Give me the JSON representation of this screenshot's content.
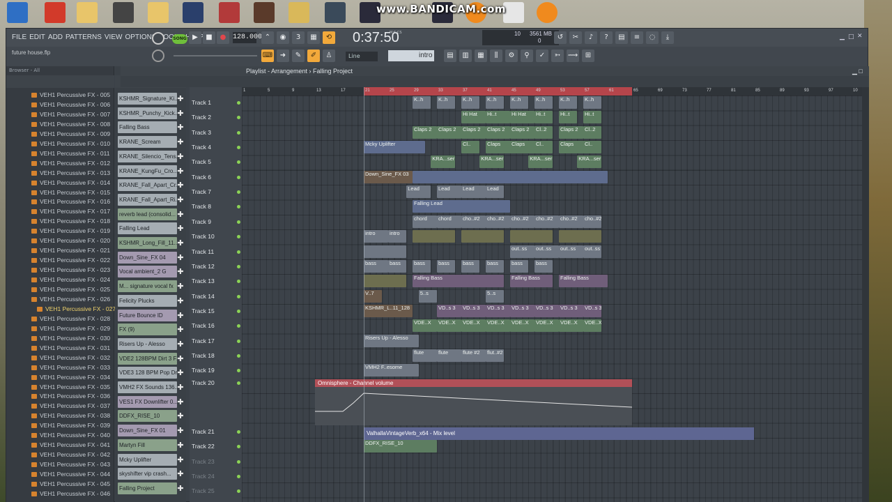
{
  "watermark": "www.BANDICAM.com",
  "menu": [
    "FILE",
    "EDIT",
    "ADD",
    "PATTERNS",
    "VIEW",
    "OPTIONS",
    "TOOLS",
    "HELP"
  ],
  "hint": "future house.flp",
  "transport": {
    "mode": "SONG",
    "tempo": "128.000",
    "time": "0:37:50",
    "time_label": "M:S:CS",
    "cpu_a": "10",
    "cpu_b": "3561 MB",
    "cpu_c": "0"
  },
  "snap": "Line",
  "pattern": "intro",
  "browser": {
    "header": "Browser - All",
    "items": [
      "VEH1 Percussive FX - 005",
      "VEH1 Percussive FX - 006",
      "VEH1 Percussive FX - 007",
      "VEH1 Percussive FX - 008",
      "VEH1 Percussive FX - 009",
      "VEH1 Percussive FX - 010",
      "VEH1 Percussive FX - 011",
      "VEH1 Percussive FX - 012",
      "VEH1 Percussive FX - 013",
      "VEH1 Percussive FX - 014",
      "VEH1 Percussive FX - 015",
      "VEH1 Percussive FX - 016",
      "VEH1 Percussive FX - 017",
      "VEH1 Percussive FX - 018",
      "VEH1 Percussive FX - 019",
      "VEH1 Percussive FX - 020",
      "VEH1 Percussive FX - 021",
      "VEH1 Percussive FX - 022",
      "VEH1 Percussive FX - 023",
      "VEH1 Percussive FX - 024",
      "VEH1 Percussive FX - 025",
      "VEH1 Percussive FX - 026",
      "VEH1 Percussive FX - 027",
      "VEH1 Percussive FX - 028",
      "VEH1 Percussive FX - 029",
      "VEH1 Percussive FX - 030",
      "VEH1 Percussive FX - 031",
      "VEH1 Percussive FX - 032",
      "VEH1 Percussive FX - 033",
      "VEH1 Percussive FX - 034",
      "VEH1 Percussive FX - 035",
      "VEH1 Percussive FX - 036",
      "VEH1 Percussive FX - 037",
      "VEH1 Percussive FX - 038",
      "VEH1 Percussive FX - 039",
      "VEH1 Percussive FX - 040",
      "VEH1 Percussive FX - 041",
      "VEH1 Percussive FX - 042",
      "VEH1 Percussive FX - 043",
      "VEH1 Percussive FX - 044",
      "VEH1 Percussive FX - 045",
      "VEH1 Percussive FX - 046"
    ],
    "selected_index": 22
  },
  "picker": [
    {
      "name": "KSHMR_Signature_Ki...",
      "kind": "pat"
    },
    {
      "name": "KSHMR_Punchy_Kick...",
      "kind": "pat"
    },
    {
      "name": "Falling Bass",
      "kind": "pat"
    },
    {
      "name": "KRANE_Scream",
      "kind": "pat"
    },
    {
      "name": "KRANE_Silencio_Tens...",
      "kind": "pat"
    },
    {
      "name": "KRANE_KungFu_Cro...",
      "kind": "pat"
    },
    {
      "name": "KRANE_Fall_Apart_Cr...",
      "kind": "pat"
    },
    {
      "name": "KRANE_Fall_Apart_Ri...",
      "kind": "pat"
    },
    {
      "name": "reverb lead (consolid...",
      "kind": "audio"
    },
    {
      "name": "Falling Lead",
      "kind": "pat"
    },
    {
      "name": "KSHMR_Long_Fill_11...",
      "kind": "audio"
    },
    {
      "name": "Down_Sine_FX 04",
      "kind": "auto"
    },
    {
      "name": "Vocal ambient_2 G",
      "kind": "auto"
    },
    {
      "name": "M... signature vocal fx",
      "kind": "audio"
    },
    {
      "name": "Felicity Plucks",
      "kind": "pat"
    },
    {
      "name": "Future Bounce ID",
      "kind": "auto"
    },
    {
      "name": "FX (9)",
      "kind": "audio"
    },
    {
      "name": "Risers Up - Alesso",
      "kind": "pat"
    },
    {
      "name": "VDE2 128BPM Dirt 3 FX",
      "kind": "audio"
    },
    {
      "name": "VDE3 128 BPM Pop Dr...",
      "kind": "pat"
    },
    {
      "name": "VMH2 FX Sounds 136...",
      "kind": "pat"
    },
    {
      "name": "VES1 FX Downlifter 0...",
      "kind": "auto"
    },
    {
      "name": "DDFX_RISE_10",
      "kind": "audio"
    },
    {
      "name": "Down_Sine_FX 01",
      "kind": "auto"
    },
    {
      "name": "Martyn Fill",
      "kind": "audio"
    },
    {
      "name": "Mcky Uplifter",
      "kind": "pat"
    },
    {
      "name": "skyshifter vip crash...",
      "kind": "pat"
    },
    {
      "name": "Falling Project",
      "kind": "audio"
    }
  ],
  "playlist": {
    "title": "Playlist - Arrangement › Falling Project",
    "ticks": [
      "1",
      "5",
      "9",
      "13",
      "17",
      "21",
      "25",
      "29",
      "33",
      "37",
      "41",
      "45",
      "49",
      "53",
      "57",
      "61",
      "65",
      "69",
      "73",
      "77",
      "81",
      "85",
      "89",
      "93",
      "97",
      "10"
    ],
    "tracks": [
      "Track 1",
      "Track 2",
      "Track 3",
      "Track 4",
      "Track 5",
      "Track 6",
      "Track 7",
      "Track 8",
      "Track 9",
      "Track 10",
      "Track 11",
      "Track 12",
      "Track 13",
      "Track 14",
      "Track 15",
      "Track 16",
      "Track 17",
      "Track 18",
      "Track 19",
      "Track 20",
      "Track 21",
      "Track 22",
      "Track 23",
      "Track 24",
      "Track 25"
    ],
    "automation1": "Omnisphere - Channel volume",
    "automation2": "ValhallaVintageVerb_x64 - Mix level",
    "clips": [
      {
        "t": 0,
        "bar": 29,
        "len": 3,
        "txt": "K..h",
        "c": "c-pat"
      },
      {
        "t": 0,
        "bar": 33,
        "len": 3,
        "txt": "K..h",
        "c": "c-pat"
      },
      {
        "t": 0,
        "bar": 37,
        "len": 3,
        "txt": "K..h",
        "c": "c-pat"
      },
      {
        "t": 0,
        "bar": 41,
        "len": 3,
        "txt": "K..h",
        "c": "c-pat"
      },
      {
        "t": 0,
        "bar": 45,
        "len": 3,
        "txt": "K..h",
        "c": "c-pat"
      },
      {
        "t": 0,
        "bar": 49,
        "len": 3,
        "txt": "K..h",
        "c": "c-pat"
      },
      {
        "t": 0,
        "bar": 53,
        "len": 3,
        "txt": "K..h",
        "c": "c-pat"
      },
      {
        "t": 0,
        "bar": 57,
        "len": 3,
        "txt": "K..h",
        "c": "c-pat"
      },
      {
        "t": 1,
        "bar": 37,
        "len": 4,
        "txt": "Hi Hat",
        "c": "c-green"
      },
      {
        "t": 1,
        "bar": 41,
        "len": 4,
        "txt": "Hi..t",
        "c": "c-green"
      },
      {
        "t": 1,
        "bar": 45,
        "len": 4,
        "txt": "Hi Hat",
        "c": "c-green"
      },
      {
        "t": 1,
        "bar": 49,
        "len": 3,
        "txt": "Hi..t",
        "c": "c-green"
      },
      {
        "t": 1,
        "bar": 53,
        "len": 3,
        "txt": "Hi..t",
        "c": "c-green"
      },
      {
        "t": 1,
        "bar": 57,
        "len": 3,
        "txt": "Hi..t",
        "c": "c-green"
      },
      {
        "t": 2,
        "bar": 29,
        "len": 4,
        "txt": "Claps 2",
        "c": "c-green"
      },
      {
        "t": 2,
        "bar": 33,
        "len": 4,
        "txt": "Claps 2",
        "c": "c-green"
      },
      {
        "t": 2,
        "bar": 37,
        "len": 4,
        "txt": "Claps 2",
        "c": "c-green"
      },
      {
        "t": 2,
        "bar": 41,
        "len": 4,
        "txt": "Claps 2",
        "c": "c-green"
      },
      {
        "t": 2,
        "bar": 45,
        "len": 4,
        "txt": "Claps 2",
        "c": "c-green"
      },
      {
        "t": 2,
        "bar": 49,
        "len": 3,
        "txt": "Cl..2",
        "c": "c-green"
      },
      {
        "t": 2,
        "bar": 53,
        "len": 4,
        "txt": "Claps 2",
        "c": "c-green"
      },
      {
        "t": 2,
        "bar": 57,
        "len": 3,
        "txt": "Cl..2",
        "c": "c-green"
      },
      {
        "t": 3,
        "bar": 21,
        "len": 10,
        "txt": "Mcky Uplifter",
        "c": "c-blue"
      },
      {
        "t": 3,
        "bar": 37,
        "len": 3,
        "txt": "Cl..",
        "c": "c-green"
      },
      {
        "t": 3,
        "bar": 41,
        "len": 5,
        "txt": "Claps",
        "c": "c-green"
      },
      {
        "t": 3,
        "bar": 45,
        "len": 5,
        "txt": "Claps",
        "c": "c-green"
      },
      {
        "t": 3,
        "bar": 49,
        "len": 3,
        "txt": "Cl..",
        "c": "c-green"
      },
      {
        "t": 3,
        "bar": 53,
        "len": 5,
        "txt": "Claps",
        "c": "c-green"
      },
      {
        "t": 3,
        "bar": 57,
        "len": 3,
        "txt": "Cl..",
        "c": "c-green"
      },
      {
        "t": 4,
        "bar": 32,
        "len": 4,
        "txt": "KRA...ser",
        "c": "c-green"
      },
      {
        "t": 4,
        "bar": 40,
        "len": 4,
        "txt": "KRA...ser",
        "c": "c-green"
      },
      {
        "t": 4,
        "bar": 48,
        "len": 4,
        "txt": "KRA...ser",
        "c": "c-green"
      },
      {
        "t": 4,
        "bar": 56,
        "len": 4,
        "txt": "KRA...ser",
        "c": "c-green"
      },
      {
        "t": 5,
        "bar": 21,
        "len": 8,
        "txt": "Down_Sine_FX 03",
        "c": "c-brown"
      },
      {
        "t": 5,
        "bar": 29,
        "len": 32,
        "txt": "",
        "c": "c-blue"
      },
      {
        "t": 6,
        "bar": 28,
        "len": 4,
        "txt": "Lead",
        "c": "c-pat"
      },
      {
        "t": 6,
        "bar": 33,
        "len": 4,
        "txt": "Lead",
        "c": "c-pat"
      },
      {
        "t": 6,
        "bar": 37,
        "len": 4,
        "txt": "Lead",
        "c": "c-pat"
      },
      {
        "t": 6,
        "bar": 41,
        "len": 3,
        "txt": "Lead",
        "c": "c-pat"
      },
      {
        "t": 7,
        "bar": 29,
        "len": 16,
        "txt": "Falling Lead",
        "c": "c-blue"
      },
      {
        "t": 8,
        "bar": 29,
        "len": 4,
        "txt": "chord",
        "c": "c-pat"
      },
      {
        "t": 8,
        "bar": 33,
        "len": 4,
        "txt": "chord",
        "c": "c-pat"
      },
      {
        "t": 8,
        "bar": 37,
        "len": 4,
        "txt": "cho..#2",
        "c": "c-pat"
      },
      {
        "t": 8,
        "bar": 41,
        "len": 4,
        "txt": "cho..#2",
        "c": "c-pat"
      },
      {
        "t": 8,
        "bar": 45,
        "len": 4,
        "txt": "cho..#2",
        "c": "c-pat"
      },
      {
        "t": 8,
        "bar": 49,
        "len": 4,
        "txt": "cho..#2",
        "c": "c-pat"
      },
      {
        "t": 8,
        "bar": 53,
        "len": 4,
        "txt": "cho..#2",
        "c": "c-pat"
      },
      {
        "t": 8,
        "bar": 57,
        "len": 3,
        "txt": "cho..#2",
        "c": "c-pat"
      },
      {
        "t": 9,
        "bar": 21,
        "len": 4,
        "txt": "intro",
        "c": "c-pat"
      },
      {
        "t": 9,
        "bar": 25,
        "len": 3,
        "txt": "intro",
        "c": "c-pat"
      },
      {
        "t": 9,
        "bar": 29,
        "len": 7,
        "txt": "",
        "c": "c-olive"
      },
      {
        "t": 9,
        "bar": 37,
        "len": 7,
        "txt": "",
        "c": "c-olive"
      },
      {
        "t": 9,
        "bar": 45,
        "len": 7,
        "txt": "",
        "c": "c-olive"
      },
      {
        "t": 9,
        "bar": 53,
        "len": 7,
        "txt": "",
        "c": "c-olive"
      },
      {
        "t": 10,
        "bar": 21,
        "len": 7,
        "txt": "",
        "c": "c-pat"
      },
      {
        "t": 10,
        "bar": 45,
        "len": 4,
        "txt": "out..ss",
        "c": "c-pat"
      },
      {
        "t": 10,
        "bar": 49,
        "len": 4,
        "txt": "out..ss",
        "c": "c-pat"
      },
      {
        "t": 10,
        "bar": 53,
        "len": 4,
        "txt": "out..ss",
        "c": "c-pat"
      },
      {
        "t": 10,
        "bar": 57,
        "len": 3,
        "txt": "out..ss",
        "c": "c-pat"
      },
      {
        "t": 11,
        "bar": 21,
        "len": 4,
        "txt": "bass",
        "c": "c-pat"
      },
      {
        "t": 11,
        "bar": 25,
        "len": 3,
        "txt": "bass",
        "c": "c-pat"
      },
      {
        "t": 11,
        "bar": 29,
        "len": 3,
        "txt": "bass",
        "c": "c-pat"
      },
      {
        "t": 11,
        "bar": 33,
        "len": 3,
        "txt": "bass",
        "c": "c-pat"
      },
      {
        "t": 11,
        "bar": 37,
        "len": 3,
        "txt": "bass",
        "c": "c-pat"
      },
      {
        "t": 11,
        "bar": 41,
        "len": 3,
        "txt": "bass",
        "c": "c-pat"
      },
      {
        "t": 11,
        "bar": 45,
        "len": 3,
        "txt": "bass",
        "c": "c-pat"
      },
      {
        "t": 11,
        "bar": 49,
        "len": 3,
        "txt": "bass",
        "c": "c-pat"
      },
      {
        "t": 12,
        "bar": 21,
        "len": 7,
        "txt": "",
        "c": "c-olive"
      },
      {
        "t": 12,
        "bar": 29,
        "len": 15,
        "txt": "Falling Bass",
        "c": "c-purple"
      },
      {
        "t": 12,
        "bar": 45,
        "len": 7,
        "txt": "Falling Bass",
        "c": "c-purple"
      },
      {
        "t": 12,
        "bar": 53,
        "len": 8,
        "txt": "Falling Bass",
        "c": "c-purple"
      },
      {
        "t": 13,
        "bar": 21,
        "len": 3,
        "txt": "V..7",
        "c": "c-brown"
      },
      {
        "t": 13,
        "bar": 30,
        "len": 3,
        "txt": "5..s",
        "c": "c-pat"
      },
      {
        "t": 13,
        "bar": 41,
        "len": 3,
        "txt": "5..s",
        "c": "c-pat"
      },
      {
        "t": 14,
        "bar": 21,
        "len": 8,
        "txt": "KSHMR_L..11_128",
        "c": "c-brown"
      },
      {
        "t": 14,
        "bar": 33,
        "len": 4,
        "txt": "VD..s 3",
        "c": "c-purple"
      },
      {
        "t": 14,
        "bar": 37,
        "len": 4,
        "txt": "VD..s 3",
        "c": "c-purple"
      },
      {
        "t": 14,
        "bar": 41,
        "len": 4,
        "txt": "VD..s 3",
        "c": "c-purple"
      },
      {
        "t": 14,
        "bar": 45,
        "len": 4,
        "txt": "VD..s 3",
        "c": "c-purple"
      },
      {
        "t": 14,
        "bar": 49,
        "len": 4,
        "txt": "VD..s 3",
        "c": "c-purple"
      },
      {
        "t": 14,
        "bar": 53,
        "len": 4,
        "txt": "VD..s 3",
        "c": "c-purple"
      },
      {
        "t": 14,
        "bar": 57,
        "len": 3,
        "txt": "VD..s 3",
        "c": "c-purple"
      },
      {
        "t": 15,
        "bar": 29,
        "len": 4,
        "txt": "VDE..X",
        "c": "c-green"
      },
      {
        "t": 15,
        "bar": 33,
        "len": 4,
        "txt": "VDE..X",
        "c": "c-green"
      },
      {
        "t": 15,
        "bar": 37,
        "len": 4,
        "txt": "VDE..X",
        "c": "c-green"
      },
      {
        "t": 15,
        "bar": 41,
        "len": 4,
        "txt": "VDE..X",
        "c": "c-green"
      },
      {
        "t": 15,
        "bar": 45,
        "len": 4,
        "txt": "VDE..X",
        "c": "c-green"
      },
      {
        "t": 15,
        "bar": 49,
        "len": 4,
        "txt": "VDE..X",
        "c": "c-green"
      },
      {
        "t": 15,
        "bar": 53,
        "len": 4,
        "txt": "VDE..X",
        "c": "c-green"
      },
      {
        "t": 15,
        "bar": 57,
        "len": 3,
        "txt": "VDE..X",
        "c": "c-green"
      },
      {
        "t": 16,
        "bar": 21,
        "len": 9,
        "txt": "Risers Up - Alesso",
        "c": "c-pat"
      },
      {
        "t": 17,
        "bar": 29,
        "len": 4,
        "txt": "flute",
        "c": "c-pat"
      },
      {
        "t": 17,
        "bar": 33,
        "len": 4,
        "txt": "flute",
        "c": "c-pat"
      },
      {
        "t": 17,
        "bar": 37,
        "len": 4,
        "txt": "flute #2",
        "c": "c-pat"
      },
      {
        "t": 17,
        "bar": 41,
        "len": 3,
        "txt": "flut..#2",
        "c": "c-pat"
      },
      {
        "t": 18,
        "bar": 21,
        "len": 9,
        "txt": "VMH2 F..esome",
        "c": "c-pat"
      },
      {
        "t": 21,
        "bar": 21,
        "len": 12,
        "txt": "DDFX_RISE_10",
        "c": "c-green"
      }
    ]
  }
}
